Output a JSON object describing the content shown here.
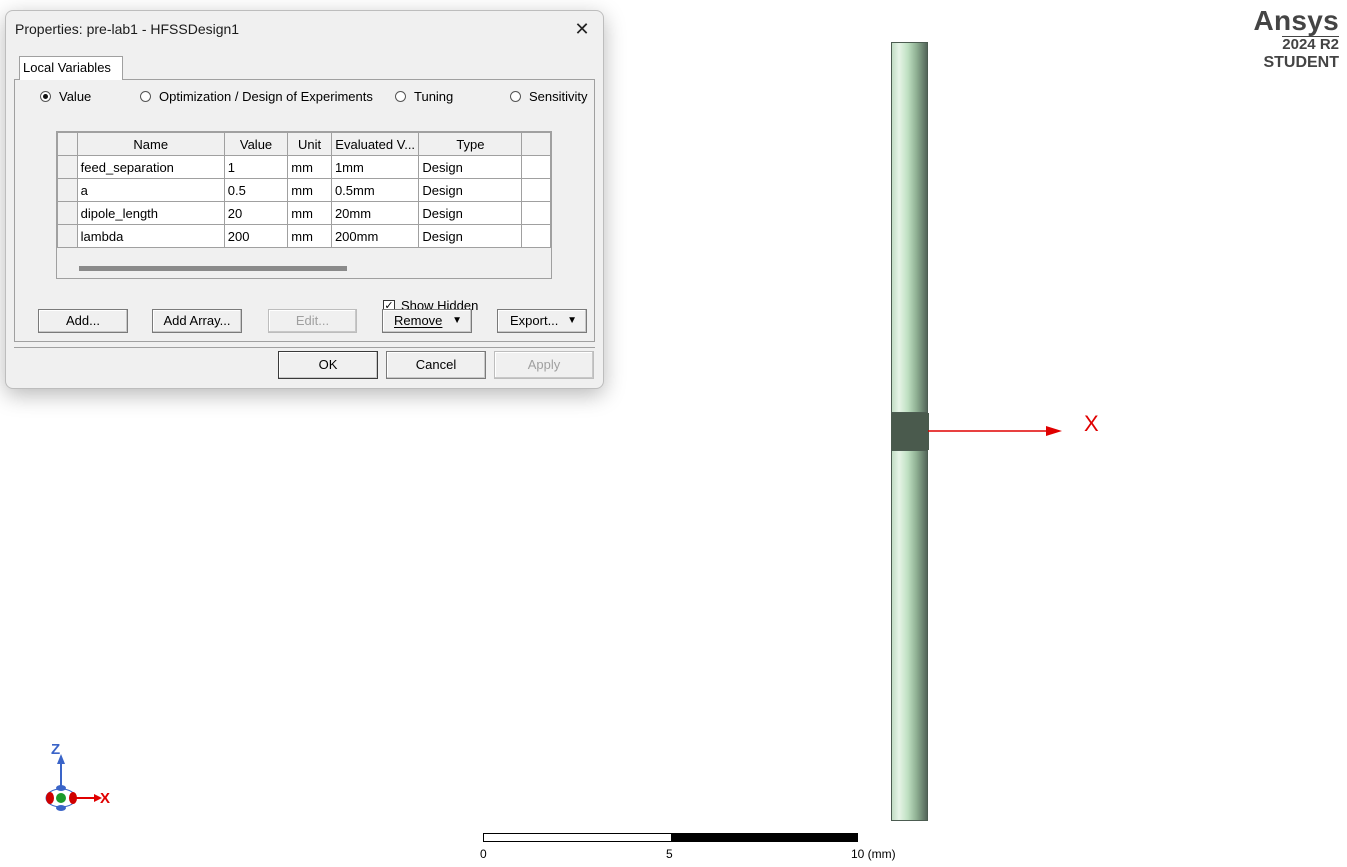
{
  "dialog": {
    "title": "Properties: pre-lab1 - HFSSDesign1",
    "close_glyph": "✕",
    "tab_label": "Local Variables",
    "radio_options": [
      {
        "label": "Value",
        "selected": true
      },
      {
        "label": "Optimization / Design of Experiments",
        "selected": false
      },
      {
        "label": "Tuning",
        "selected": false
      },
      {
        "label": "Sensitivity",
        "selected": false
      }
    ],
    "table": {
      "headers": [
        "Name",
        "Value",
        "Unit",
        "Evaluated V...",
        "Type"
      ],
      "rows": [
        [
          "feed_separation",
          "1",
          "mm",
          "1mm",
          "Design"
        ],
        [
          "a",
          "0.5",
          "mm",
          "0.5mm",
          "Design"
        ],
        [
          "dipole_length",
          "20",
          "mm",
          "20mm",
          "Design"
        ],
        [
          "lambda",
          "200",
          "mm",
          "200mm",
          "Design"
        ]
      ]
    },
    "show_hidden_label": "Show Hidden",
    "show_hidden_checked": true,
    "buttons": {
      "add": "Add...",
      "add_array": "Add Array...",
      "edit": "Edit...",
      "remove": "Remove",
      "export": "Export...",
      "ok": "OK",
      "cancel": "Cancel",
      "apply": "Apply"
    }
  },
  "viewport": {
    "brand_name": "Ansys",
    "brand_version": "2024 R2",
    "brand_edition": "STUDENT",
    "x_axis_label": "X",
    "triad": {
      "z": "Z",
      "x": "X"
    },
    "scale_labels": [
      "0",
      "5",
      "10 (mm)"
    ],
    "colors": {
      "axis": "#e00000",
      "rod": "#bfe0c2",
      "feed": "#4a5a4d",
      "triad_z": "#3a64c8"
    }
  }
}
